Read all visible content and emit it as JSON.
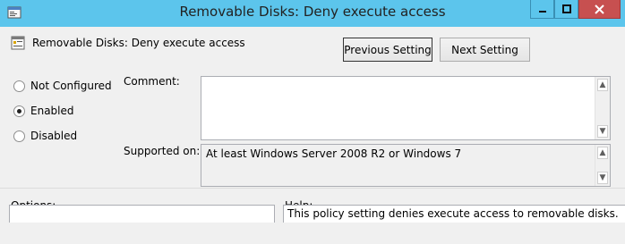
{
  "window": {
    "title": "Removable Disks: Deny execute access",
    "controls": {
      "minimize": "—",
      "maximize": "☐",
      "close": "✕"
    }
  },
  "policy": {
    "name": "Removable Disks: Deny execute access"
  },
  "nav": {
    "previous_setting": "Previous Setting",
    "next_setting": "Next Setting"
  },
  "state": {
    "options": [
      {
        "label": "Not Configured",
        "checked": false
      },
      {
        "label": "Enabled",
        "checked": true
      },
      {
        "label": "Disabled",
        "checked": false
      }
    ]
  },
  "comment": {
    "label": "Comment:",
    "value": ""
  },
  "supported": {
    "label": "Supported on:",
    "value": "At least Windows Server 2008 R2 or Windows 7"
  },
  "sections": {
    "options_label": "Options:",
    "help_label": "Help:"
  },
  "help": {
    "text": "This policy setting denies execute access to removable disks."
  },
  "colors": {
    "titlebar": "#5cc5ec",
    "close_button": "#c75050",
    "dialog_bg": "#f0f0f0"
  }
}
